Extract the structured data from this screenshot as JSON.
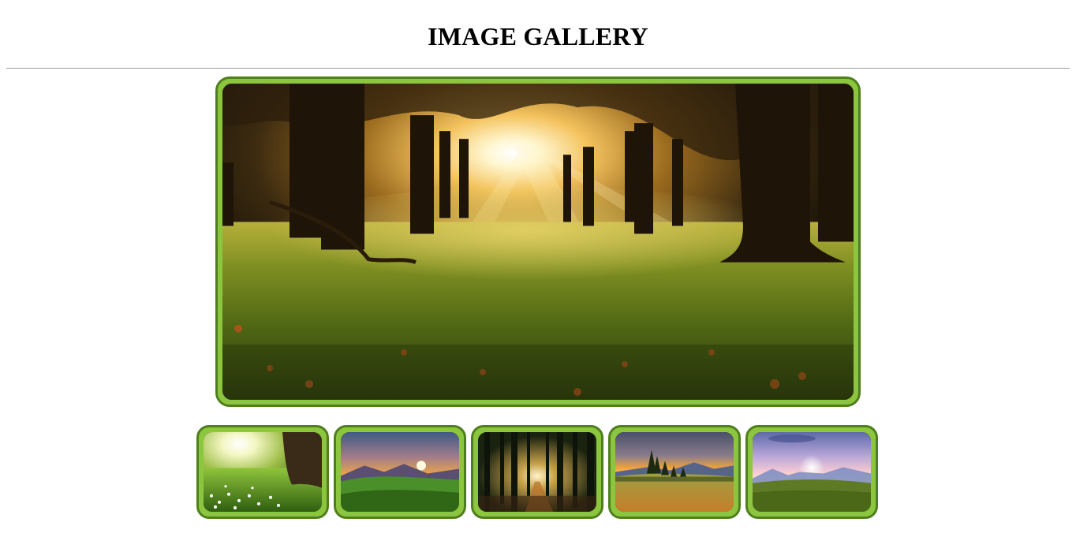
{
  "page": {
    "title": "IMAGE GALLERY"
  },
  "theme": {
    "frame_color": "#8cc63f",
    "frame_border_color": "#4f7f1c",
    "divider_color": "#9a9a9a"
  },
  "gallery": {
    "main_image": {
      "scene": "sunlit-forest-meadow"
    },
    "thumbnails": [
      {
        "scene": "sunny-meadow-with-tree-and-white-flowers"
      },
      {
        "scene": "mountain-sunset-over-green-hills"
      },
      {
        "scene": "forest-path-with-sun-through-trees"
      },
      {
        "scene": "mountain-valley-sunset-with-pines"
      },
      {
        "scene": "sunrise-over-field-with-misty-mountains"
      }
    ]
  }
}
